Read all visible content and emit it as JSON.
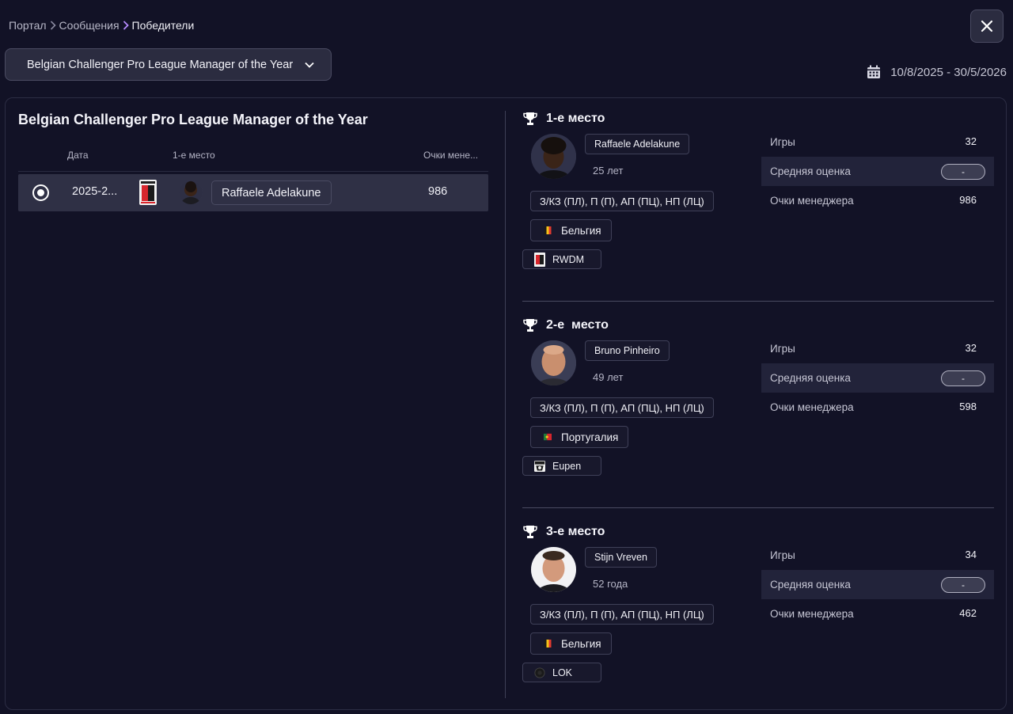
{
  "breadcrumb": {
    "items": [
      "Портал",
      "Сообщения",
      "Победители"
    ]
  },
  "award_select": {
    "selected": "Belgian Challenger Pro League Manager of the Year"
  },
  "date_range": "10/8/2025 - 30/5/2026",
  "left": {
    "title": "Belgian Challenger Pro League Manager of the Year",
    "headers": {
      "date": "Дата",
      "first": "1-е место",
      "points": "Очки мене..."
    },
    "rows": [
      {
        "date": "2025-2...",
        "name": "Raffaele Adelakune",
        "points": "986"
      }
    ]
  },
  "places": [
    {
      "title": "1-е место",
      "name": "Raffaele Adelakune",
      "age": "25 лет",
      "licenses": "З/КЗ (ПЛ), П (П), АП (ПЦ), НП (ЛЦ)",
      "nation": "Бельгия",
      "club": "RWDM",
      "stats": [
        {
          "label": "Игры",
          "value": "32"
        },
        {
          "label": "Средняя оценка",
          "value": "-"
        },
        {
          "label": "Очки менеджера",
          "value": "986"
        }
      ]
    },
    {
      "title": "2-е  место",
      "name": "Bruno Pinheiro",
      "age": "49 лет",
      "licenses": "З/КЗ (ПЛ), П (П), АП (ПЦ), НП (ЛЦ)",
      "nation": "Португалия",
      "club": "Eupen",
      "stats": [
        {
          "label": "Игры",
          "value": "32"
        },
        {
          "label": "Средняя оценка",
          "value": "-"
        },
        {
          "label": "Очки менеджера",
          "value": "598"
        }
      ]
    },
    {
      "title": "3-е место",
      "name": "Stijn Vreven",
      "age": "52 года",
      "licenses": "З/КЗ (ПЛ), П (П), АП (ПЦ), НП (ЛЦ)",
      "nation": "Бельгия",
      "club": "LOK",
      "stats": [
        {
          "label": "Игры",
          "value": "34"
        },
        {
          "label": "Средняя оценка",
          "value": "-"
        },
        {
          "label": "Очки менеджера",
          "value": "462"
        }
      ]
    }
  ],
  "colors": {
    "background": "#121226",
    "row_selected": "#2f3045",
    "accent_chevron": "#b78cff"
  }
}
